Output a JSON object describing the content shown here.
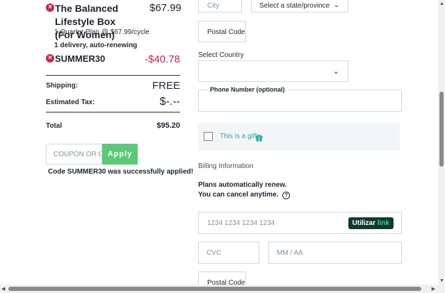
{
  "cart": {
    "item_title_line1": "The Balanced Lifestyle Box",
    "item_title_line2": "(For Women)",
    "item_price": "$67.99",
    "item_plan": "1 Quarter Plan @ $67.99/cycle",
    "item_delivery": "1 delivery, auto-renewing",
    "coupon_code": "SUMMER30",
    "coupon_discount": "-$40.78",
    "shipping_label": "Shipping:",
    "shipping_value": "FREE",
    "tax_label": "Estimated Tax:",
    "tax_value": "$-.--",
    "total_label": "Total",
    "total_value": "$95.20",
    "coupon_placeholder": "COUPON OR GIFT",
    "apply_label": "Apply",
    "coupon_success": "Code SUMMER30 was successfully applied!"
  },
  "shipping_form": {
    "city_placeholder": "City",
    "state_placeholder": "Select a state/province",
    "postal_placeholder": "Postal Code",
    "country_label": "Select Country",
    "country_value": "",
    "phone_label": "Phone Number (optional)",
    "gift_label": "This is a gift"
  },
  "billing": {
    "section_label": "Billing Information",
    "renew_line1": "Plans automatically renew.",
    "renew_line2": "You can cancel anytime.",
    "card_placeholder": "1234 1234 1234 1234",
    "link_badge_prefix": "Utilizar",
    "link_badge_word": "link",
    "cvc_placeholder": "CVC",
    "expiry_placeholder": "MM / AA",
    "postal_placeholder": "Postal Code"
  },
  "colors": {
    "remove_icon": "#c7254e",
    "discount": "#c7254e",
    "apply_button": "#5cc87a",
    "gift_text": "#2aa9a0",
    "link_badge_bg": "#0f3b2e",
    "link_green": "#33d17a"
  }
}
